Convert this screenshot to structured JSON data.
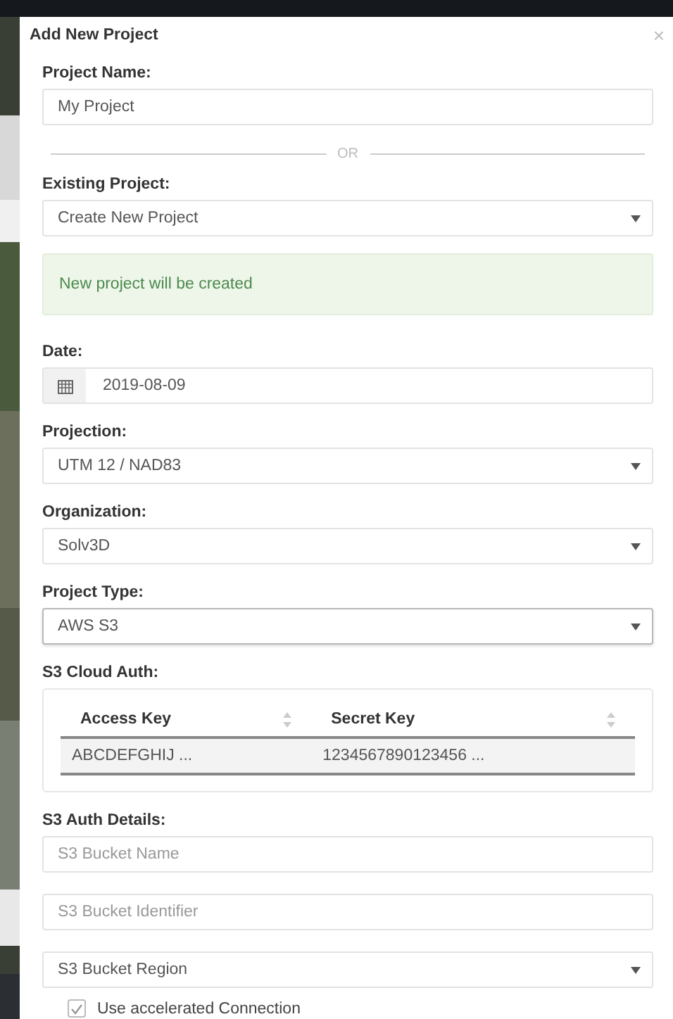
{
  "dialog": {
    "title": "Add New Project",
    "close": "×"
  },
  "fields": [
    {
      "kind": "input",
      "label": "Project Name:",
      "value": "My Project"
    },
    {
      "kind": "divider",
      "text": "OR"
    },
    {
      "kind": "select",
      "label": "Existing Project:",
      "value": "Create New Project",
      "focused": false
    },
    {
      "kind": "alert",
      "text": "New project will be created"
    },
    {
      "kind": "date",
      "label": "Date:",
      "value": "2019-08-09"
    },
    {
      "kind": "select",
      "label": "Projection:",
      "value": "UTM 12 / NAD83",
      "focused": false
    },
    {
      "kind": "select",
      "label": "Organization:",
      "value": "Solv3D",
      "focused": false
    },
    {
      "kind": "select",
      "label": "Project Type:",
      "value": "AWS S3",
      "focused": true
    },
    {
      "kind": "table",
      "label": "S3 Cloud Auth:",
      "columns": [
        "Access Key",
        "Secret Key"
      ],
      "rows": [
        [
          "ABCDEFGHIJ ...",
          "1234567890123456 ..."
        ]
      ]
    },
    {
      "kind": "input",
      "label": "S3 Auth Details:",
      "placeholder": "S3 Bucket Name"
    },
    {
      "kind": "input",
      "placeholder": "S3 Bucket Identifier"
    },
    {
      "kind": "select",
      "value": "S3 Bucket Region",
      "focused": false
    },
    {
      "kind": "checkbox",
      "label": "Use accelerated Connection",
      "checked": true
    }
  ]
}
